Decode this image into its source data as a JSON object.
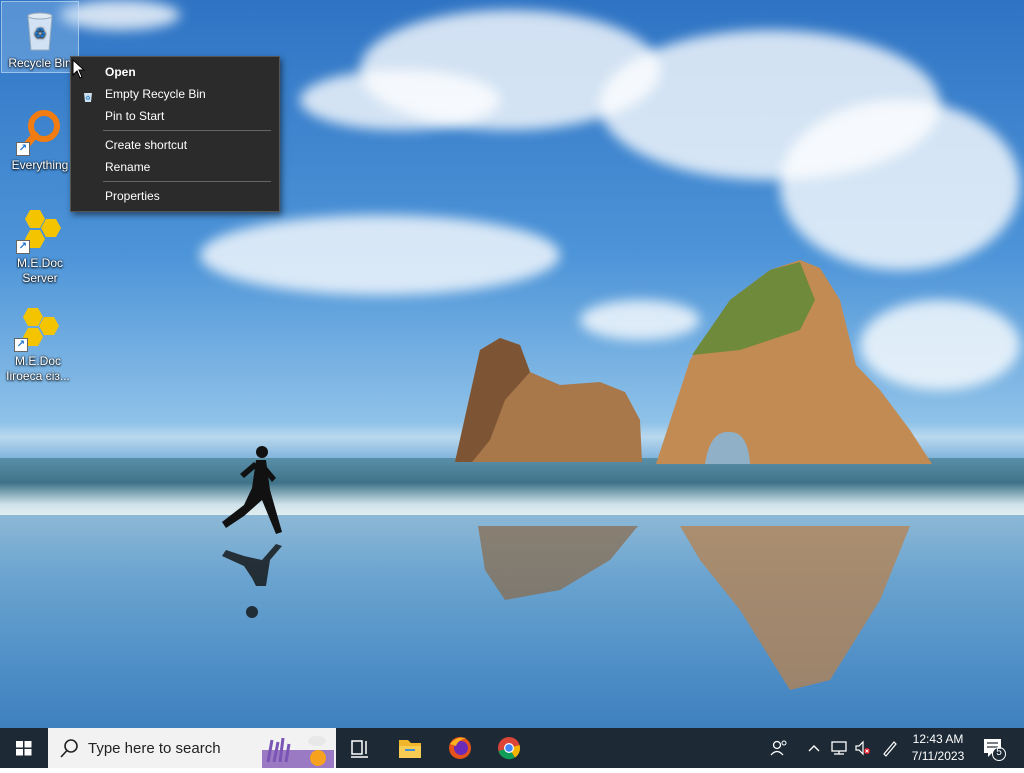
{
  "desktop": {
    "icons": [
      {
        "label": "Recycle Bin"
      },
      {
        "label": "Everything"
      },
      {
        "label": "M.E.Doc Server"
      },
      {
        "label": "M.E.Doc Іігоеса єіз..."
      }
    ]
  },
  "context_menu": {
    "items": [
      {
        "label": "Open"
      },
      {
        "label": "Empty Recycle Bin"
      },
      {
        "label": "Pin to Start"
      },
      {
        "label": "Create shortcut"
      },
      {
        "label": "Rename"
      },
      {
        "label": "Properties"
      }
    ]
  },
  "taskbar": {
    "search_placeholder": "Type here to search",
    "clock_time": "12:43 AM",
    "clock_date": "7/11/2023",
    "notification_count": "5"
  }
}
